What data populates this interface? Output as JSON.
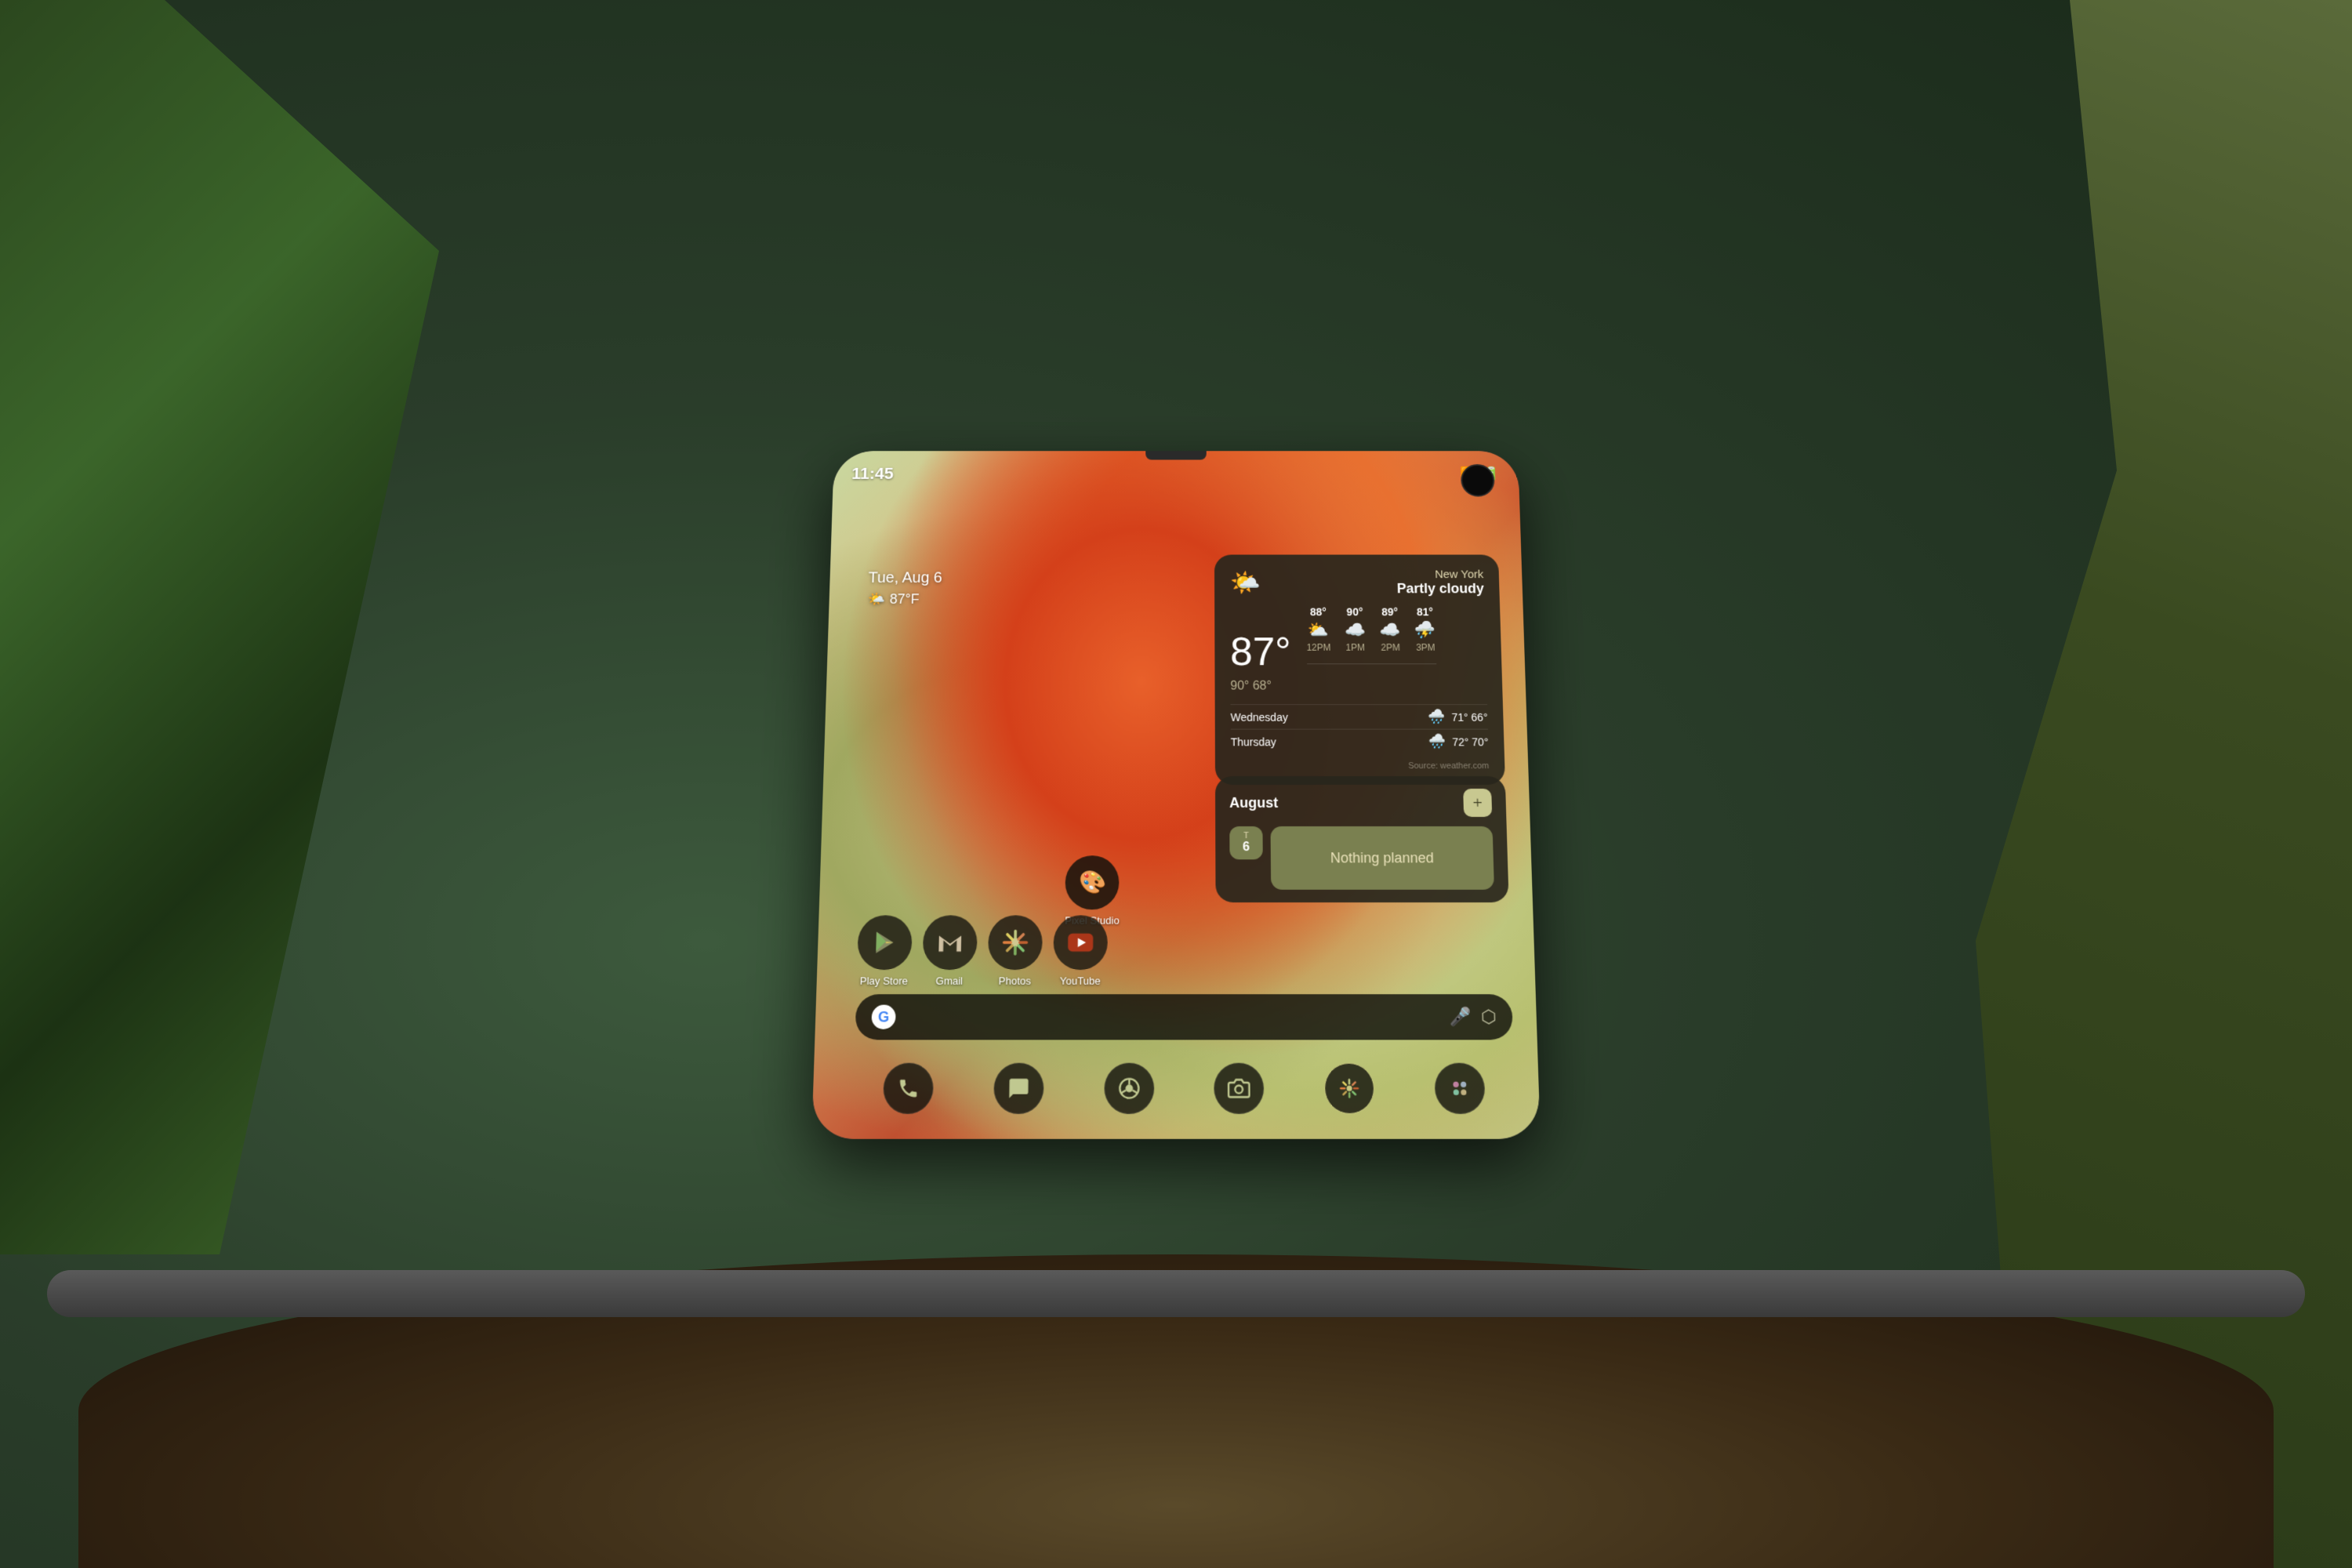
{
  "background": {
    "colors": {
      "outer": "#4a5a4a",
      "pot": "#3a3a3a"
    }
  },
  "device": {
    "hinge": true
  },
  "status_bar": {
    "time": "11:45",
    "wifi_icon": "wifi",
    "battery_icon": "battery"
  },
  "date_weather_topleft": {
    "date": "Tue, Aug 6",
    "temp": "87°F",
    "temp_icon": "🌤️"
  },
  "weather_widget": {
    "city": "New York",
    "condition": "Partly cloudy",
    "main_temp": "87°",
    "high": "90°",
    "low": "68°",
    "main_icon": "🌤️",
    "hourly": [
      {
        "time": "12PM",
        "temp": "88°",
        "icon": "⛅"
      },
      {
        "time": "1PM",
        "temp": "90°",
        "icon": "☁️"
      },
      {
        "time": "2PM",
        "temp": "89°",
        "icon": "☁️"
      },
      {
        "time": "3PM",
        "temp": "81°",
        "icon": "⛈️"
      }
    ],
    "forecast": [
      {
        "day": "Wednesday",
        "icon": "🌧️",
        "high": "71°",
        "low": "66°"
      },
      {
        "day": "Thursday",
        "icon": "🌧️",
        "high": "72°",
        "low": "70°"
      }
    ],
    "source": "Source: weather.com"
  },
  "calendar_widget": {
    "month": "August",
    "add_label": "+",
    "date_letter": "T",
    "date_number": "6",
    "nothing_planned": "Nothing planned"
  },
  "apps": {
    "pixel_studio": {
      "label": "Pixel Studio",
      "icon": "🎨"
    },
    "row": [
      {
        "id": "play-store",
        "label": "Play Store",
        "icon": "▶"
      },
      {
        "id": "gmail",
        "label": "Gmail",
        "icon": "✉"
      },
      {
        "id": "photos",
        "label": "Photos",
        "icon": "❋"
      },
      {
        "id": "youtube",
        "label": "YouTube",
        "icon": "▶"
      }
    ]
  },
  "search_bar": {
    "g_label": "G",
    "mic_icon": "🎤",
    "lens_icon": "📷"
  },
  "dock": {
    "items": [
      {
        "id": "phone",
        "icon": "📞",
        "active": false
      },
      {
        "id": "messages",
        "icon": "💬",
        "active": false
      },
      {
        "id": "chrome",
        "icon": "◎",
        "active": false
      },
      {
        "id": "camera",
        "icon": "📷",
        "active": false
      },
      {
        "id": "photos-dock",
        "icon": "❋",
        "active": true
      },
      {
        "id": "pixel-studio-dock",
        "icon": "🎨",
        "active": false
      }
    ]
  }
}
